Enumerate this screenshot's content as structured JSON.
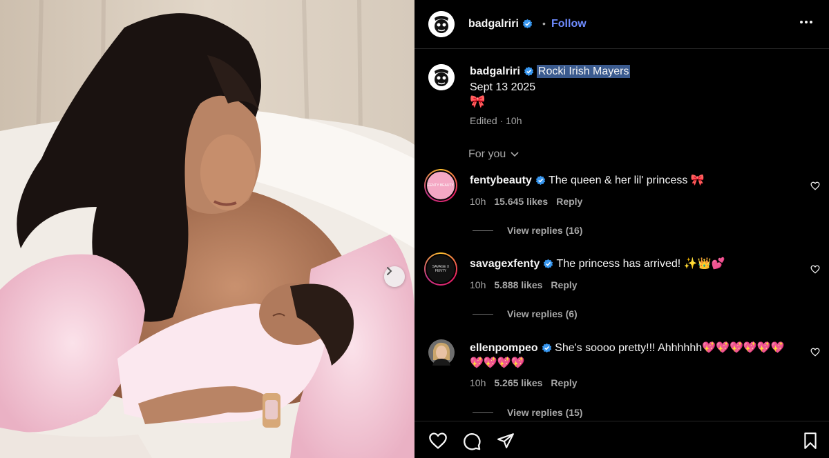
{
  "post": {
    "username": "badgalriri",
    "follow_label": "Follow",
    "separator": "•",
    "caption": {
      "highlighted_text": "Rocki Irish Mayers",
      "date": "Sept 13 2025",
      "emoji": "🎀",
      "meta": "Edited · 10h"
    }
  },
  "comments_filter": {
    "label": "For you"
  },
  "comments": [
    {
      "username": "fentybeauty",
      "avatar_text": "FENTY BEAUTY",
      "text": "The queen & her lil' princess 🎀",
      "time": "10h",
      "likes": "15.645 likes",
      "reply_label": "Reply",
      "view_replies": "View replies (16)"
    },
    {
      "username": "savagexfenty",
      "avatar_text": "SAVAGE X FENTY",
      "text": "The princess has arrived! ✨👑💕",
      "time": "10h",
      "likes": "5.888 likes",
      "reply_label": "Reply",
      "view_replies": "View replies (6)"
    },
    {
      "username": "ellenpompeo",
      "avatar_text": "",
      "text": "She's soooo pretty!!! Ahhhhhh💖💖💖💖💖💖💖💖💖💖",
      "time": "10h",
      "likes": "5.265 likes",
      "reply_label": "Reply",
      "view_replies": "View replies (15)"
    }
  ],
  "icons": [
    "verified-badge-icon",
    "more-options-icon",
    "chevron-down-icon",
    "heart-icon",
    "comment-icon",
    "share-icon",
    "bookmark-icon",
    "next-arrow-icon"
  ],
  "colors": {
    "background": "#000000",
    "text_primary": "#f5f5f5",
    "text_secondary": "#a8a8a8",
    "accent_link": "#6f8cff",
    "verified": "#3897f0",
    "highlight": "#3b5b8f"
  }
}
